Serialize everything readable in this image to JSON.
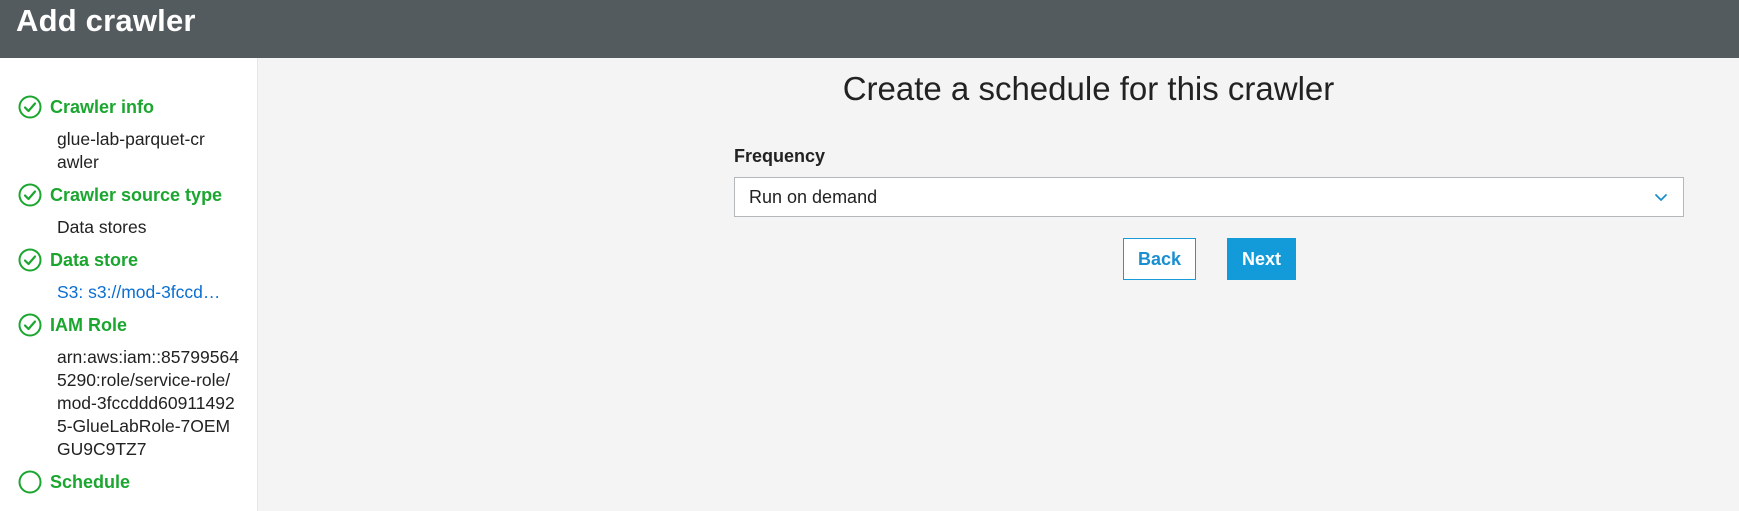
{
  "header": {
    "title": "Add crawler"
  },
  "sidebar": {
    "steps": [
      {
        "title": "Crawler info",
        "value": "glue-lab-parquet-crawler",
        "completed": true
      },
      {
        "title": "Crawler source type",
        "value": "Data stores",
        "completed": true
      },
      {
        "title": "Data store",
        "value": "S3: s3://mod-3fccd…",
        "completed": true
      },
      {
        "title": "IAM Role",
        "value": "arn:aws:iam::857995645290:role/service-role/mod-3fccddd609114925-GlueLabRole-7OEMGU9C9TZ7",
        "completed": true
      },
      {
        "title": "Schedule",
        "value": "",
        "completed": false
      }
    ]
  },
  "main": {
    "title": "Create a schedule for this crawler",
    "frequency_label": "Frequency",
    "frequency_value": "Run on demand",
    "back_label": "Back",
    "next_label": "Next"
  },
  "colors": {
    "accent_green": "#1ba62f",
    "accent_blue": "#139bd9",
    "header_bg": "#545b5f"
  }
}
